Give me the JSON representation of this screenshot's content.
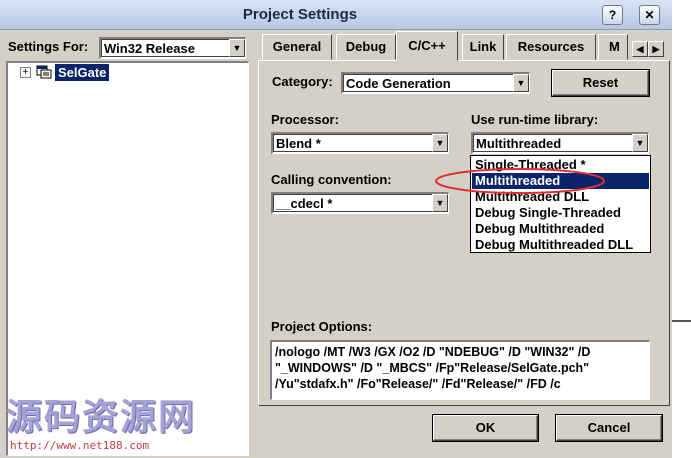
{
  "window": {
    "title": "Project Settings",
    "help_glyph": "?",
    "close_glyph": "✕"
  },
  "settings_for": {
    "label": "Settings For:",
    "value": "Win32 Release"
  },
  "tree": {
    "expander": "+",
    "project": "SelGate"
  },
  "tabs": [
    {
      "label": "General",
      "active": false
    },
    {
      "label": "Debug",
      "active": false
    },
    {
      "label": "C/C++",
      "active": true
    },
    {
      "label": "Link",
      "active": false
    },
    {
      "label": "Resources",
      "active": false
    },
    {
      "label": "M",
      "active": false
    }
  ],
  "tab_scroll": {
    "left": "◀",
    "right": "▶"
  },
  "category": {
    "label": "Category:",
    "value": "Code Generation"
  },
  "reset_button": {
    "label": "Reset"
  },
  "processor": {
    "label": "Processor:",
    "value": "Blend *"
  },
  "runtime_library": {
    "label": "Use run-time library:",
    "value": "Multithreaded",
    "options": [
      "Single-Threaded *",
      "Multithreaded",
      "Multithreaded DLL",
      "Debug Single-Threaded",
      "Debug Multithreaded",
      "Debug Multithreaded DLL"
    ],
    "selected_index": 1
  },
  "calling_convention": {
    "label": "Calling convention:",
    "value": "__cdecl *"
  },
  "project_options": {
    "label": "Project Options:",
    "text": "/nologo /MT /W3 /GX /O2 /D \"NDEBUG\" /D \"WIN32\" /D \"_WINDOWS\" /D \"_MBCS\" /Fp\"Release/SelGate.pch\" /Yu\"stdafx.h\" /Fo\"Release/\" /Fd\"Release/\" /FD /c"
  },
  "ok_button": {
    "label": "OK"
  },
  "cancel_button": {
    "label": "Cancel"
  },
  "watermark": {
    "text": "源码资源网",
    "url": "http://www.net188.com"
  },
  "colors": {
    "selection": "#0a246a",
    "annotation": "#e03030",
    "dialog": "#d4d0c8"
  },
  "dropdown_glyph": "▼"
}
